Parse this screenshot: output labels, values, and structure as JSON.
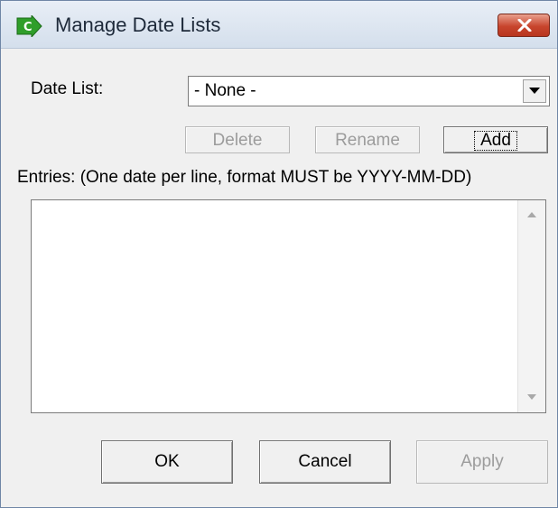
{
  "window": {
    "title": "Manage Date Lists"
  },
  "date_list": {
    "label": "Date List:",
    "selected": "- None -"
  },
  "list_buttons": {
    "delete": "Delete",
    "rename": "Rename",
    "add": "Add"
  },
  "entries": {
    "label": "Entries: (One date per line, format MUST be YYYY-MM-DD)",
    "value": ""
  },
  "footer": {
    "ok": "OK",
    "cancel": "Cancel",
    "apply": "Apply"
  },
  "icons": {
    "app": "green-arrow-c-icon",
    "close": "close-icon",
    "dropdown": "chevron-down-icon",
    "scroll_up": "scroll-up-arrow-icon",
    "scroll_down": "scroll-down-arrow-icon"
  },
  "colors": {
    "close_button": "#c8452d",
    "app_icon": "#2f9e2a",
    "disabled_text": "#9c9c9c"
  }
}
